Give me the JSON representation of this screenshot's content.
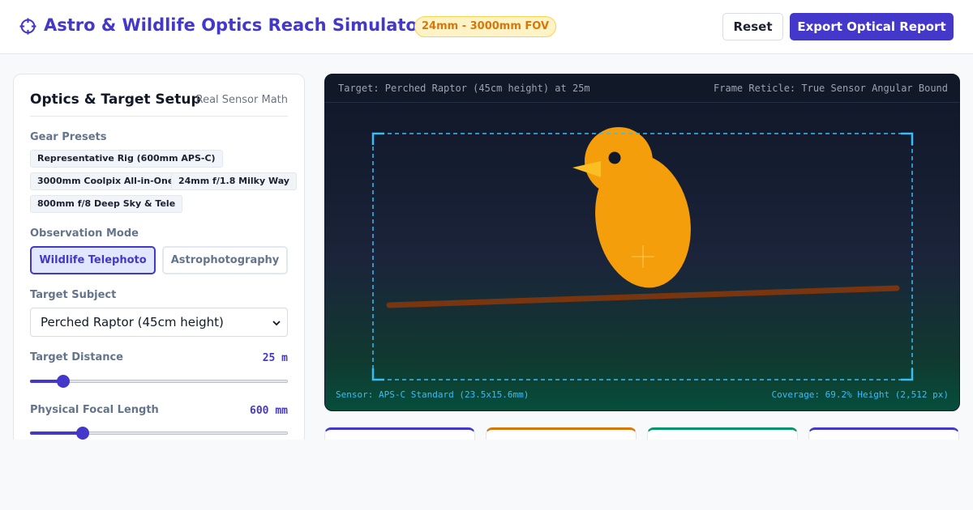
{
  "header": {
    "title": "Astro & Wildlife Optics Reach Simulator",
    "badge": "24mm - 3000mm FOV",
    "reset_label": "Reset",
    "export_label": "Export Optical Report",
    "icon": "crosshair-icon"
  },
  "panel": {
    "title": "Optics & Target Setup",
    "subtitle": "Real Sensor Math",
    "presets_label": "Gear Presets",
    "presets": [
      "Representative Rig (600mm APS-C)",
      "3000mm Coolpix All-in-One",
      "24mm f/1.8 Milky Way",
      "800mm f/8 Deep Sky & Tele"
    ],
    "mode_label": "Observation Mode",
    "modes": [
      "Wildlife Telephoto",
      "Astrophotography"
    ],
    "active_mode": "Wildlife Telephoto",
    "target_label": "Target Subject",
    "target_value": "Perched Raptor (45cm height)",
    "distance_label": "Target Distance",
    "distance_value": "25 m",
    "distance_fraction": 0.13,
    "focal_label": "Physical Focal Length",
    "focal_value": "600 mm",
    "focal_fraction": 0.205
  },
  "viewport": {
    "target_text": "Target: Perched Raptor (45cm height) at 25m",
    "reticle_text": "Frame Reticle: True Sensor Angular Bound",
    "sensor_text": "Sensor: APS-C Standard (23.5x15.6mm)",
    "coverage_text": "Coverage: 69.2% Height (2,512 px)"
  },
  "colors": {
    "accent": "#4338ca",
    "badge_text": "#d97706",
    "reticle": "#38bdf8",
    "bird": "#f59e0b",
    "branch": "#78350f"
  },
  "stat_cards": [
    {
      "accent": "#4338ca"
    },
    {
      "accent": "#d97706"
    },
    {
      "accent": "#059669"
    },
    {
      "accent": "#4338ca"
    }
  ]
}
